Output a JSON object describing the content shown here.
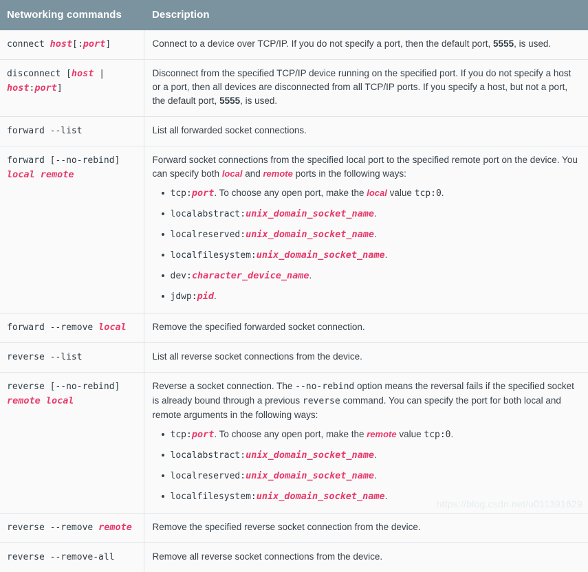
{
  "table": {
    "headers": {
      "command": "Networking commands",
      "description": "Description"
    },
    "header_bg": "#7b939f",
    "accent_variable_color": "#e8396a",
    "rows": [
      {
        "command_parts": [
          {
            "text": "connect ",
            "style": "code"
          },
          {
            "text": "host",
            "style": "var"
          },
          {
            "text": "[:",
            "style": "code"
          },
          {
            "text": "port",
            "style": "var"
          },
          {
            "text": "]",
            "style": "code"
          }
        ],
        "description_paragraphs": [
          [
            {
              "text": "Connect to a device over TCP/IP. If you do not specify a port, then the default port, ",
              "style": "plain"
            },
            {
              "text": "5555",
              "style": "bold"
            },
            {
              "text": ", is used.",
              "style": "plain"
            }
          ]
        ],
        "bullets": []
      },
      {
        "command_parts": [
          {
            "text": "disconnect [",
            "style": "code"
          },
          {
            "text": "host",
            "style": "var"
          },
          {
            "text": " | ",
            "style": "code"
          },
          {
            "text": "host",
            "style": "var"
          },
          {
            "text": ":",
            "style": "code"
          },
          {
            "text": "port",
            "style": "var"
          },
          {
            "text": "]",
            "style": "code"
          }
        ],
        "description_paragraphs": [
          [
            {
              "text": "Disconnect from the specified TCP/IP device running on the specified port. If you do not specify a host or a port, then all devices are disconnected from all TCP/IP ports. If you specify a host, but not a port, the default port, ",
              "style": "plain"
            },
            {
              "text": "5555",
              "style": "bold"
            },
            {
              "text": ", is used.",
              "style": "plain"
            }
          ]
        ],
        "bullets": []
      },
      {
        "command_parts": [
          {
            "text": "forward --list",
            "style": "code"
          }
        ],
        "description_paragraphs": [
          [
            {
              "text": "List all forwarded socket connections.",
              "style": "plain"
            }
          ]
        ],
        "bullets": []
      },
      {
        "command_parts": [
          {
            "text": "forward [--no-rebind] ",
            "style": "code"
          },
          {
            "text": "local remote",
            "style": "var"
          }
        ],
        "description_paragraphs": [
          [
            {
              "text": "Forward socket connections from the specified local port to the specified remote port on the device. You can specify both ",
              "style": "plain"
            },
            {
              "text": "local",
              "style": "var-inline"
            },
            {
              "text": " and ",
              "style": "plain"
            },
            {
              "text": "remote",
              "style": "var-inline"
            },
            {
              "text": " ports in the following ways:",
              "style": "plain"
            }
          ]
        ],
        "bullets": [
          [
            {
              "text": "tcp:",
              "style": "code"
            },
            {
              "text": "port",
              "style": "var"
            },
            {
              "text": ". To choose any open port, make the ",
              "style": "sans"
            },
            {
              "text": "local",
              "style": "var-inline"
            },
            {
              "text": " value ",
              "style": "sans"
            },
            {
              "text": "tcp:0",
              "style": "code"
            },
            {
              "text": ".",
              "style": "sans"
            }
          ],
          [
            {
              "text": "localabstract:",
              "style": "code"
            },
            {
              "text": "unix_domain_socket_name",
              "style": "var"
            },
            {
              "text": ".",
              "style": "sans"
            }
          ],
          [
            {
              "text": "localreserved:",
              "style": "code"
            },
            {
              "text": "unix_domain_socket_name",
              "style": "var"
            },
            {
              "text": ".",
              "style": "sans"
            }
          ],
          [
            {
              "text": "localfilesystem:",
              "style": "code"
            },
            {
              "text": "unix_domain_socket_name",
              "style": "var"
            },
            {
              "text": ".",
              "style": "sans"
            }
          ],
          [
            {
              "text": "dev:",
              "style": "code"
            },
            {
              "text": "character_device_name",
              "style": "var"
            },
            {
              "text": ".",
              "style": "sans"
            }
          ],
          [
            {
              "text": "jdwp:",
              "style": "code"
            },
            {
              "text": "pid",
              "style": "var"
            },
            {
              "text": ".",
              "style": "sans"
            }
          ]
        ]
      },
      {
        "command_parts": [
          {
            "text": "forward --remove ",
            "style": "code"
          },
          {
            "text": "local",
            "style": "var"
          }
        ],
        "description_paragraphs": [
          [
            {
              "text": "Remove the specified forwarded socket connection.",
              "style": "plain"
            }
          ]
        ],
        "bullets": []
      },
      {
        "command_parts": [
          {
            "text": "reverse --list",
            "style": "code"
          }
        ],
        "description_paragraphs": [
          [
            {
              "text": "List all reverse socket connections from the device.",
              "style": "plain"
            }
          ]
        ],
        "bullets": []
      },
      {
        "command_parts": [
          {
            "text": "reverse [--no-rebind] ",
            "style": "code"
          },
          {
            "text": "remote local",
            "style": "var"
          }
        ],
        "description_paragraphs": [
          [
            {
              "text": "Reverse a socket connection. The ",
              "style": "plain"
            },
            {
              "text": "--no-rebind",
              "style": "code"
            },
            {
              "text": " option means the reversal fails if the specified socket is already bound through a previous ",
              "style": "plain"
            },
            {
              "text": "reverse",
              "style": "code"
            },
            {
              "text": " command. You can specify the port for both local and remote arguments in the following ways:",
              "style": "plain"
            }
          ]
        ],
        "bullets": [
          [
            {
              "text": "tcp:",
              "style": "code"
            },
            {
              "text": "port",
              "style": "var"
            },
            {
              "text": ". To choose any open port, make the ",
              "style": "sans"
            },
            {
              "text": "remote",
              "style": "var-inline"
            },
            {
              "text": " value ",
              "style": "sans"
            },
            {
              "text": "tcp:0",
              "style": "code"
            },
            {
              "text": ".",
              "style": "sans"
            }
          ],
          [
            {
              "text": "localabstract:",
              "style": "code"
            },
            {
              "text": "unix_domain_socket_name",
              "style": "var"
            },
            {
              "text": ".",
              "style": "sans"
            }
          ],
          [
            {
              "text": "localreserved:",
              "style": "code"
            },
            {
              "text": "unix_domain_socket_name",
              "style": "var"
            },
            {
              "text": ".",
              "style": "sans"
            }
          ],
          [
            {
              "text": "localfilesystem:",
              "style": "code"
            },
            {
              "text": "unix_domain_socket_name",
              "style": "var"
            },
            {
              "text": ".",
              "style": "sans"
            }
          ]
        ]
      },
      {
        "command_parts": [
          {
            "text": "reverse --remove ",
            "style": "code"
          },
          {
            "text": "remote",
            "style": "var"
          }
        ],
        "description_paragraphs": [
          [
            {
              "text": "Remove the specified reverse socket connection from the device.",
              "style": "plain"
            }
          ]
        ],
        "bullets": []
      },
      {
        "command_parts": [
          {
            "text": "reverse --remove-all",
            "style": "code"
          }
        ],
        "description_paragraphs": [
          [
            {
              "text": "Remove all reverse socket connections from the device.",
              "style": "plain"
            }
          ]
        ],
        "bullets": []
      }
    ]
  },
  "watermark": {
    "text": "https://blog.csdn.net/u011391629"
  }
}
